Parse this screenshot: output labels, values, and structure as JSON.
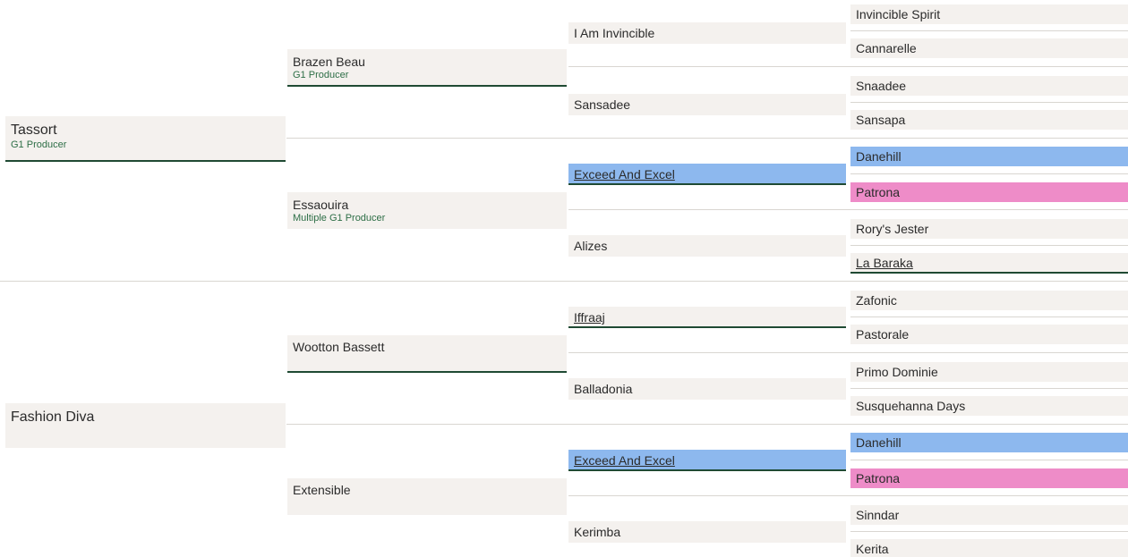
{
  "pedigree": {
    "sire": {
      "name": "Tassort",
      "note": "G1 Producer"
    },
    "dam": {
      "name": "Fashion Diva",
      "note": ""
    },
    "sire_sire": {
      "name": "Brazen Beau",
      "note": "G1 Producer"
    },
    "sire_dam": {
      "name": "Essaouira",
      "note": "Multiple G1 Producer"
    },
    "dam_sire": {
      "name": "Wootton Bassett",
      "note": ""
    },
    "dam_dam": {
      "name": "Extensible",
      "note": ""
    },
    "gen3": [
      {
        "name": "I Am Invincible"
      },
      {
        "name": "Sansadee"
      },
      {
        "name": "Exceed And Excel"
      },
      {
        "name": "Alizes"
      },
      {
        "name": "Iffraaj"
      },
      {
        "name": "Balladonia"
      },
      {
        "name": "Exceed And Excel"
      },
      {
        "name": "Kerimba"
      }
    ],
    "gen4": [
      {
        "name": "Invincible Spirit"
      },
      {
        "name": "Cannarelle"
      },
      {
        "name": "Snaadee"
      },
      {
        "name": "Sansapa"
      },
      {
        "name": "Danehill"
      },
      {
        "name": "Patrona"
      },
      {
        "name": "Rory's Jester"
      },
      {
        "name": "La Baraka"
      },
      {
        "name": "Zafonic"
      },
      {
        "name": "Pastorale"
      },
      {
        "name": "Primo Dominie"
      },
      {
        "name": "Susquehanna Days"
      },
      {
        "name": "Danehill"
      },
      {
        "name": "Patrona"
      },
      {
        "name": "Sinndar"
      },
      {
        "name": "Kerita"
      }
    ],
    "highlight_colors": {
      "blue": "#8db8ee",
      "pink": "#ee8cc8",
      "underline": "#1f4a33",
      "note": "#2d6e46"
    }
  }
}
